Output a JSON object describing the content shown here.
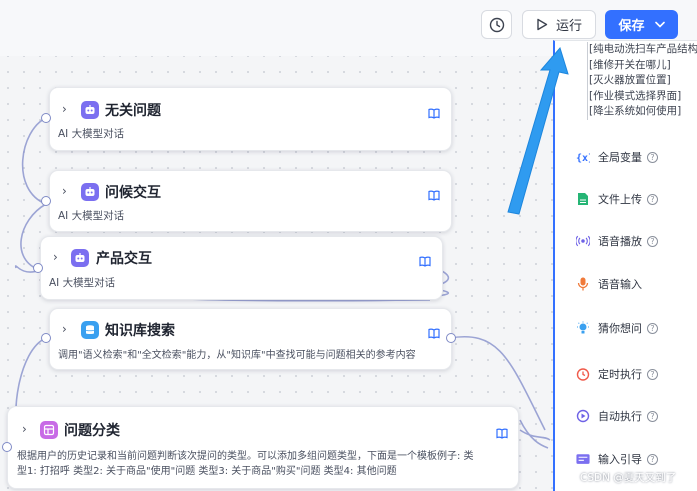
{
  "toolbar": {
    "history_icon": "clock-icon",
    "run_label": "运行",
    "save_label": "保存"
  },
  "colors": {
    "primary": "#3370ff",
    "arrow": "#2f9bf0",
    "robot_icon_bg": "#7b6ff0",
    "kb_icon_bg": "#3aa0f0",
    "classify_icon_bg": "#c86be6"
  },
  "nodes": [
    {
      "title": "无关问题",
      "subtitle": "AI 大模型对话",
      "icon": "robot-icon"
    },
    {
      "title": "问候交互",
      "subtitle": "AI 大模型对话",
      "icon": "robot-icon"
    },
    {
      "title": "产品交互",
      "subtitle": "AI 大模型对话",
      "icon": "robot-icon"
    },
    {
      "title": "知识库搜索",
      "subtitle": "调用\"语义检索\"和\"全文检索\"能力，从\"知识库\"中查找可能与问题相关的参考内容",
      "icon": "database-icon"
    },
    {
      "title": "问题分类",
      "subtitle_line1": "根据用户的历史记录和当前问题判断该次提问的类型。可以添加多组问题类型，下面是一个模板例子: 类",
      "subtitle_line2": "型1: 打招呼 类型2: 关于商品\"使用\"问题 类型3: 关于商品\"购买\"问题 类型4: 其他问题",
      "icon": "classify-icon"
    }
  ],
  "snippet_lines": [
    "[纯电动洗扫车产品结构",
    "[维修开关在哪儿]",
    "[灭火器放置位置]",
    "[作业模式选择界面]",
    "[降尘系统如何使用]"
  ],
  "tools": [
    {
      "label": "全局变量",
      "icon": "variable-icon"
    },
    {
      "label": "文件上传",
      "icon": "file-upload-icon"
    },
    {
      "label": "语音播放",
      "icon": "speaker-icon"
    },
    {
      "label": "语音输入",
      "icon": "microphone-icon"
    },
    {
      "label": "猜你想问",
      "icon": "lightbulb-icon"
    },
    {
      "label": "定时执行",
      "icon": "timer-icon"
    },
    {
      "label": "自动执行",
      "icon": "auto-run-icon"
    },
    {
      "label": "输入引导",
      "icon": "input-guide-icon"
    }
  ],
  "watermark": "CSDN @夏天又到了"
}
